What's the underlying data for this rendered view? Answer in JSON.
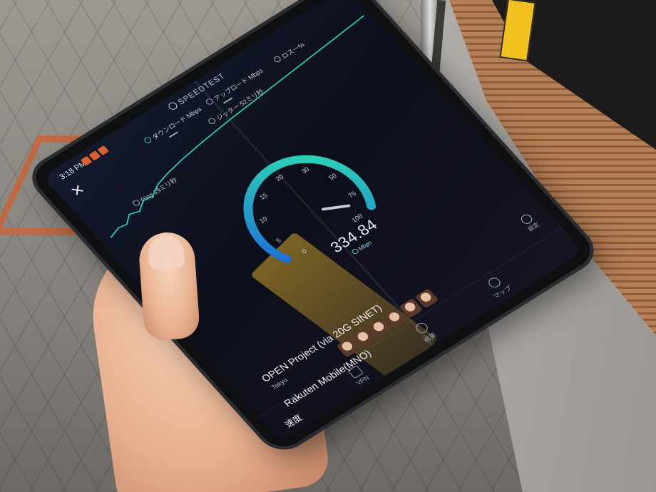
{
  "app": {
    "title": "SPEEDTEST",
    "status_time": "3:18 PM"
  },
  "metrics": {
    "download_label": "ダウンロード Mbps",
    "upload_label": "アップロード Mbps",
    "loss_label": "ロス一%",
    "jitter_label": "ジッター 52ミリ秒",
    "ping_label": "Ping 19ミリ秒",
    "download_value": "—",
    "upload_value": "—"
  },
  "gauge": {
    "value": "334.84",
    "unit": "Mbps",
    "ticks": [
      "0",
      "5",
      "10",
      "15",
      "20",
      "30",
      "50",
      "75",
      "100"
    ],
    "reading": 334.84,
    "max": 100,
    "accent_start": "#1f6fd6",
    "accent_end": "#2fe0b1"
  },
  "server": {
    "name": "OPEN Project (via 20G SINET)",
    "location": "Tokyo",
    "carrier": "Rakuten Mobile(MNO)",
    "settings_label": "設定"
  },
  "nav": {
    "speed": "速度",
    "vpn": "VPN",
    "results": "結果",
    "map": "マップ"
  },
  "icons": [
    "close-icon",
    "speedtest-logo-icon",
    "download-icon",
    "upload-icon",
    "packet-loss-icon",
    "jitter-icon",
    "ping-icon",
    "mbps-icon",
    "settings-icon",
    "vpn-icon",
    "results-icon",
    "map-icon"
  ]
}
